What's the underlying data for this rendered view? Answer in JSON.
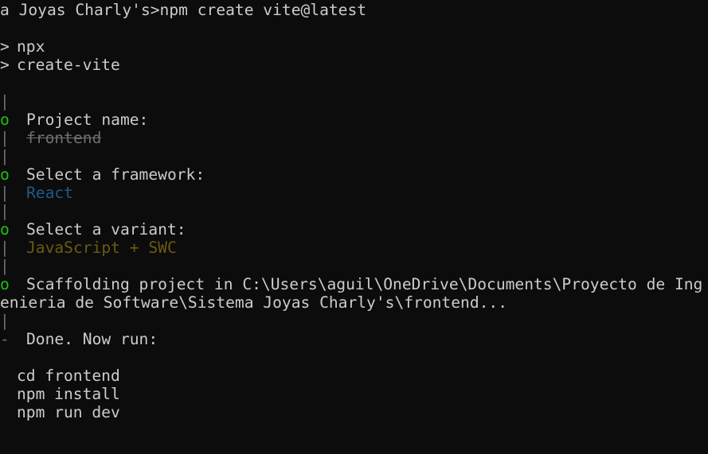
{
  "terminal": {
    "prompt_line": "a Joyas Charly's>npm create vite@latest",
    "npx_arrow": ">",
    "npx_text": "npx",
    "create_arrow": ">",
    "create_text": "create-vite",
    "bar_glyph": "|",
    "step_glyph": "o",
    "end_glyph": "-",
    "project_name_label": "Project name:",
    "project_name_value": "frontend",
    "framework_label": "Select a framework:",
    "framework_value": "React",
    "variant_label": "Select a variant:",
    "variant_value": "JavaScript + SWC",
    "scaffold_line1": "Scaffolding project in C:\\Users\\aguil\\OneDrive\\Documents\\Proyecto de Ing",
    "scaffold_line2": "enieria de Software\\Sistema Joyas Charly's\\frontend...",
    "done_label": "Done. Now run:",
    "commands": [
      "cd frontend",
      "npm install",
      "npm run dev"
    ]
  },
  "colors": {
    "background": "#0c0c0c",
    "text": "#cccccc",
    "dim": "#6f6f6f",
    "green": "#16c60c",
    "blue": "#1e5b8a",
    "yellow": "#6b5a12"
  }
}
